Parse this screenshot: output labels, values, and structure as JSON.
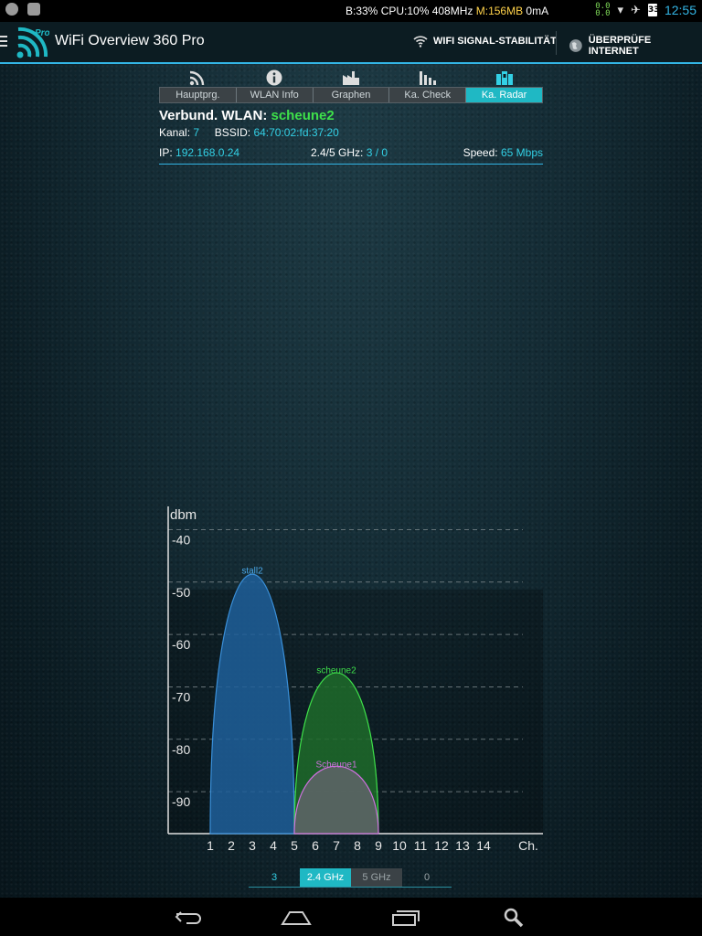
{
  "status_bar": {
    "info_prefix": "B:33% CPU:10% 408MHz ",
    "info_mem": "M:156MB",
    "info_suffix": " 0mA",
    "net_up": "0.0",
    "net_down": "0.0",
    "battery": "33",
    "clock": "12:55"
  },
  "action_bar": {
    "title": "WiFi Overview 360 Pro",
    "signal_button": "WIFI SIGNAL-STABILITÄT",
    "internet_button": "ÜBERPRÜFE INTERNET"
  },
  "tabs": [
    {
      "label": "Hauptprg.",
      "icon": "wifi-feed-icon"
    },
    {
      "label": "WLAN Info",
      "icon": "info-icon"
    },
    {
      "label": "Graphen",
      "icon": "factory-icon"
    },
    {
      "label": "Ka. Check",
      "icon": "bar-chart-icon"
    },
    {
      "label": "Ka. Radar",
      "icon": "radar-icon",
      "active": true
    }
  ],
  "connection": {
    "label": "Verbund. WLAN:",
    "ssid": "scheune2",
    "channel_label": "Kanal:",
    "channel": "7",
    "bssid_label": "BSSID:",
    "bssid": "64:70:02:fd:37:20",
    "ip_label": "IP:",
    "ip": "192.168.0.24",
    "band_label": "2.4/5 GHz:",
    "band_value": "3 / 0",
    "speed_label": "Speed:",
    "speed": "65 Mbps"
  },
  "chart_data": {
    "type": "area",
    "ylabel": "dbm",
    "xlabel": "Ch.",
    "y_ticks": [
      -40,
      -50,
      -60,
      -70,
      -80,
      -90
    ],
    "ylim": [
      -98,
      -38
    ],
    "x_ticks": [
      1,
      2,
      3,
      4,
      5,
      6,
      7,
      8,
      9,
      10,
      11,
      12,
      13,
      14
    ],
    "grid": true,
    "series": [
      {
        "name": "stall2",
        "channel": 3,
        "x_start": 1,
        "x_end": 5,
        "peak_dbm": -48,
        "color": "#1f5f9a",
        "stroke": "#3a8fd8",
        "label_color": "#4aa8e8"
      },
      {
        "name": "scheune2",
        "channel": 7,
        "x_start": 5,
        "x_end": 9,
        "peak_dbm": -67,
        "color": "#1f6b2a",
        "stroke": "#3ee04a",
        "label_color": "#3ee04a"
      },
      {
        "name": "Scheune1",
        "channel": 7,
        "x_start": 5,
        "x_end": 9,
        "peak_dbm": -85,
        "color": "#5f6468",
        "stroke": "#d070e0",
        "label_color": "#d070e0"
      }
    ]
  },
  "band_selector": {
    "count_24": "3",
    "label_24": "2.4 GHz",
    "label_5": "5 GHz",
    "count_5": "0"
  }
}
